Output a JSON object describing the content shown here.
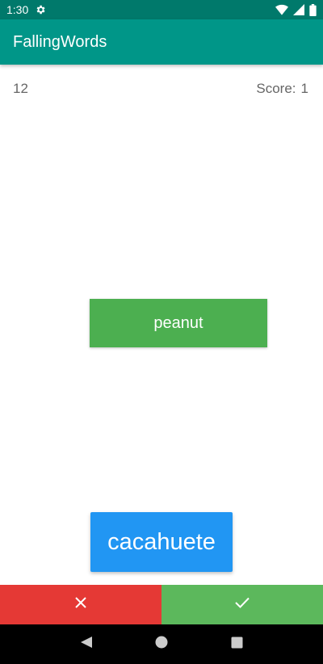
{
  "status_bar": {
    "time": "1:30",
    "icons": [
      "gear-icon",
      "wifi-icon",
      "signal-icon",
      "battery-icon"
    ]
  },
  "app_bar": {
    "title": "FallingWords"
  },
  "game": {
    "counter": "12",
    "score_label": "Score:",
    "score_value": "1",
    "falling_word": "peanut",
    "target_word": "cacahuete"
  },
  "actions": {
    "wrong_icon": "close-icon",
    "correct_icon": "check-icon"
  },
  "nav_bar": {
    "icons": [
      "back-icon",
      "home-icon",
      "recents-icon"
    ]
  },
  "colors": {
    "status_bar": "#00796b",
    "app_bar": "#009688",
    "falling_word": "#4caf50",
    "target_word": "#2196f3",
    "wrong": "#e53935",
    "correct": "#5cb85c"
  }
}
